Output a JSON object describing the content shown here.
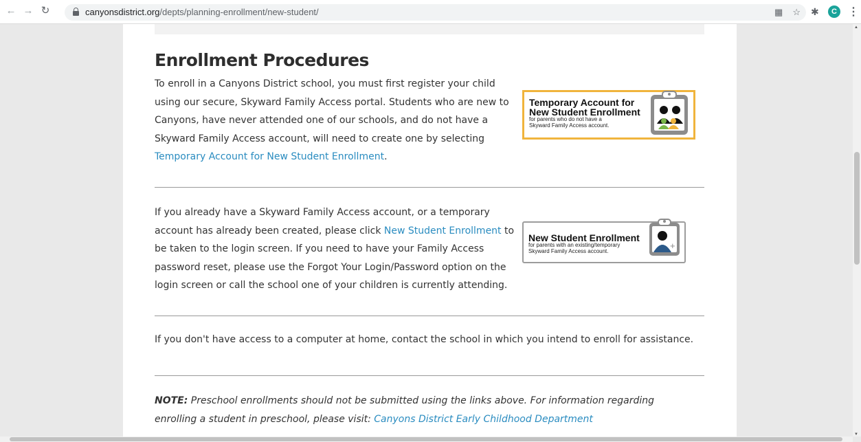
{
  "browser": {
    "url_domain": "canyonsdistrict.org",
    "url_path": "/depts/planning-enrollment/new-student/",
    "profile_initial": "C"
  },
  "content": {
    "heading": "Enrollment Procedures",
    "p1_text_a": "To enroll in a Canyons District school, you must first register your child using our secure, Skyward Family Access portal. Students who are new to Canyons, have never attended one of our schools, and do not have a Skyward Family Access account, will need to create one by selecting ",
    "p1_link": "Temporary Account for New Student Enrollment",
    "p1_text_b": ".",
    "p2_text_a": "If you already have a Skyward Family Access account, or a temporary account has already been created, please click ",
    "p2_link": "New Student Enrollment",
    "p2_text_b": " to be taken to the login screen.  If you need to have your Family Access password reset, please use the Forgot Your Login/Password option on the login screen or call the school one of your children is currently attending.",
    "p3_text": "If you don't have access to a computer at home, contact the school in which you intend to enroll for assistance.",
    "note_label": "NOTE:",
    "note_text": " Preschool enrollments should not be submitted using the links above. For information regarding enrolling a student in preschool, please visit: ",
    "note_link": "Canyons District Early Childhood Department"
  },
  "badges": {
    "temp": {
      "title_line1": "Temporary Account for",
      "title_line2": "New Student Enrollment",
      "sub_line1": "for parents who do not have a",
      "sub_line2": "Skyward Family Access account.",
      "accent": "#f0b43c"
    },
    "new": {
      "title": "New Student Enrollment",
      "sub_line1": "for parents with an existing/temporary",
      "sub_line2": "Skyward Family Access account."
    }
  },
  "colors": {
    "link": "#2a8cc0",
    "border_gold": "#f0b43c"
  }
}
